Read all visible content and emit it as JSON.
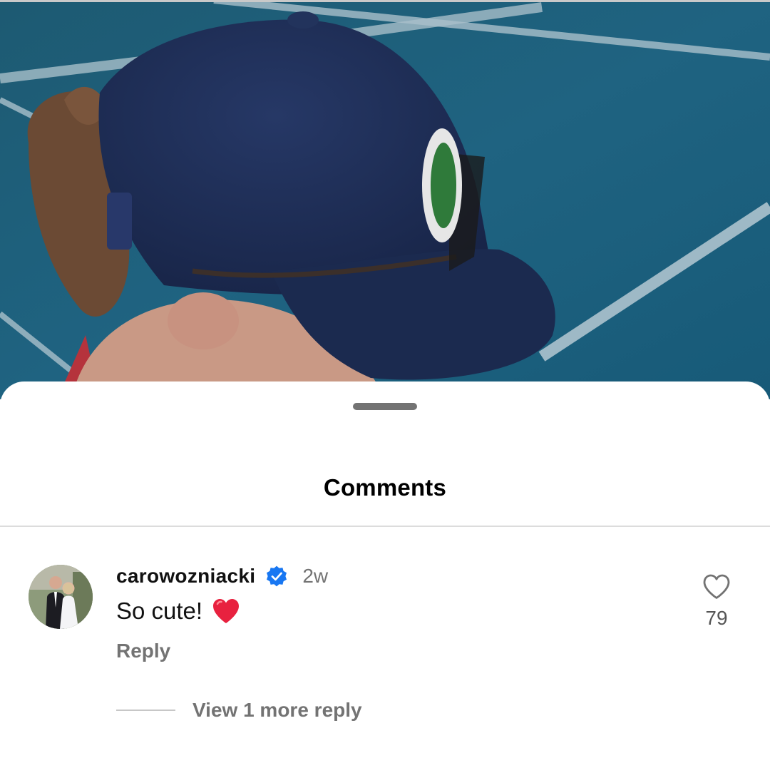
{
  "sheet": {
    "title": "Comments"
  },
  "comment": {
    "username": "carowozniacki",
    "verified": true,
    "time": "2w",
    "text": "So cute!",
    "emoji": "red-heart",
    "reply_label": "Reply",
    "like_count": "79",
    "view_replies_label": "View 1 more reply"
  },
  "icons": {
    "verified": "verified-badge-icon",
    "like": "heart-outline-icon"
  },
  "colors": {
    "verified_blue": "#1877f2",
    "secondary_text": "#737373",
    "emoji_red": "#e0245e",
    "court_blue": "#1f5e78",
    "cap_navy": "#1e2e52"
  }
}
